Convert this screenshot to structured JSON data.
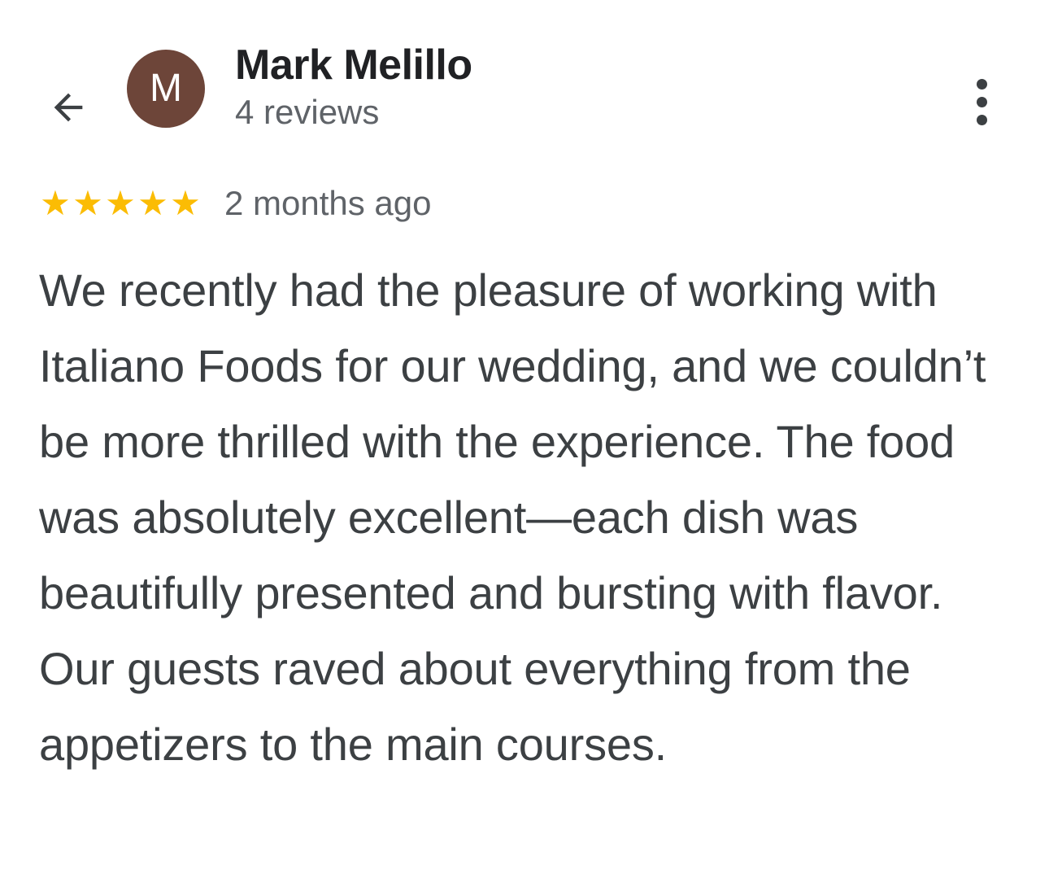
{
  "reviewer": {
    "initial": "M",
    "name": "Mark Melillo",
    "reviews_count": "4 reviews",
    "avatar_color": "#6d4539"
  },
  "nav": {
    "back_icon": "arrow-left-icon",
    "more_icon": "more-vert-icon"
  },
  "review": {
    "rating": 5,
    "rating_max": 5,
    "star_color": "#fbbc04",
    "date": "2 months ago",
    "text": "We recently had the pleasure of working with Italiano Foods for our wedding, and we couldn’t be more thrilled with the experience. The food was absolutely excellent—each dish was beautifully presented and bursting with flavor. Our guests raved about everything from the appetizers to the main courses."
  }
}
